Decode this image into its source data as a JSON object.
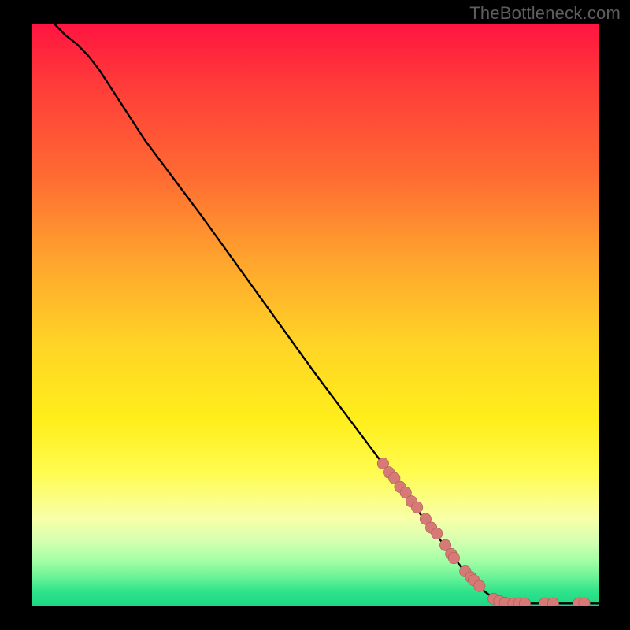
{
  "watermark": "TheBottleneck.com",
  "colors": {
    "frame_bg": "#000000",
    "watermark": "#5e5e5e",
    "curve": "#000000",
    "marker_fill": "#d77a76",
    "marker_stroke": "#a45a57"
  },
  "chart_data": {
    "type": "line",
    "title": "",
    "xlabel": "",
    "ylabel": "",
    "xlim": [
      0,
      100
    ],
    "ylim": [
      0,
      100
    ],
    "grid": false,
    "legend": false,
    "curve": [
      {
        "x": 4,
        "y": 100
      },
      {
        "x": 6,
        "y": 98
      },
      {
        "x": 8,
        "y": 96.5
      },
      {
        "x": 10,
        "y": 94.5
      },
      {
        "x": 12,
        "y": 92
      },
      {
        "x": 14,
        "y": 89
      },
      {
        "x": 20,
        "y": 80
      },
      {
        "x": 30,
        "y": 67
      },
      {
        "x": 40,
        "y": 53.5
      },
      {
        "x": 50,
        "y": 40
      },
      {
        "x": 60,
        "y": 27
      },
      {
        "x": 70,
        "y": 14
      },
      {
        "x": 78,
        "y": 4
      },
      {
        "x": 82,
        "y": 1
      },
      {
        "x": 85,
        "y": 0.5
      },
      {
        "x": 90,
        "y": 0.5
      },
      {
        "x": 95,
        "y": 0.5
      },
      {
        "x": 100,
        "y": 0.5
      }
    ],
    "markers": [
      {
        "x": 62,
        "y": 24.5
      },
      {
        "x": 63,
        "y": 23
      },
      {
        "x": 64,
        "y": 22
      },
      {
        "x": 65,
        "y": 20.5
      },
      {
        "x": 66,
        "y": 19.5
      },
      {
        "x": 67,
        "y": 18
      },
      {
        "x": 68,
        "y": 17
      },
      {
        "x": 69.5,
        "y": 15
      },
      {
        "x": 70.5,
        "y": 13.5
      },
      {
        "x": 71.5,
        "y": 12.5
      },
      {
        "x": 73,
        "y": 10.5
      },
      {
        "x": 74,
        "y": 9
      },
      {
        "x": 74.5,
        "y": 8.3
      },
      {
        "x": 76.5,
        "y": 6
      },
      {
        "x": 77.5,
        "y": 5
      },
      {
        "x": 78,
        "y": 4.5
      },
      {
        "x": 79,
        "y": 3.5
      },
      {
        "x": 81.5,
        "y": 1.3
      },
      {
        "x": 82.5,
        "y": 0.9
      },
      {
        "x": 83.5,
        "y": 0.6
      },
      {
        "x": 85,
        "y": 0.5
      },
      {
        "x": 86,
        "y": 0.5
      },
      {
        "x": 87,
        "y": 0.5
      },
      {
        "x": 90.5,
        "y": 0.5
      },
      {
        "x": 92,
        "y": 0.5
      },
      {
        "x": 96.5,
        "y": 0.5
      },
      {
        "x": 97.5,
        "y": 0.5
      }
    ]
  }
}
